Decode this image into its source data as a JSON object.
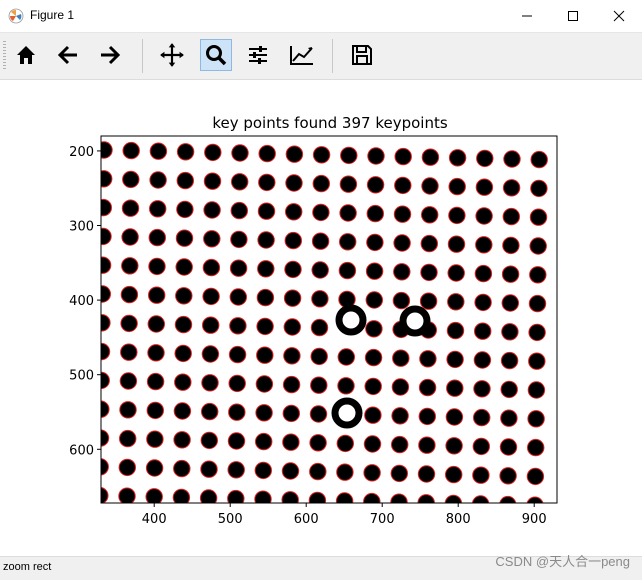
{
  "window": {
    "title": "Figure 1",
    "minimize": "–",
    "maximize": "☐",
    "close": "✕"
  },
  "toolbar": {
    "buttons": [
      {
        "name": "home-icon",
        "label": "Home"
      },
      {
        "name": "back-icon",
        "label": "Back"
      },
      {
        "name": "forward-icon",
        "label": "Forward"
      },
      {
        "name": "pan-icon",
        "label": "Pan"
      },
      {
        "name": "zoom-icon",
        "label": "Zoom",
        "active": true
      },
      {
        "name": "configure-subplots-icon",
        "label": "Configure subplots"
      },
      {
        "name": "edit-axis-icon",
        "label": "Edit axis"
      },
      {
        "name": "save-icon",
        "label": "Save"
      }
    ]
  },
  "plot": {
    "title": "key points found 397 keypoints",
    "x_ticks": [
      "400",
      "500",
      "600",
      "700",
      "800",
      "900"
    ],
    "y_ticks": [
      "200",
      "300",
      "400",
      "500",
      "600"
    ],
    "xlim": [
      330,
      930
    ],
    "ylim": [
      672,
      180
    ],
    "dot_color": "#000000",
    "keypoint_color": "#e02020"
  },
  "status": {
    "mode": "zoom rect"
  },
  "watermark": "CSDN @天人合一peng"
}
